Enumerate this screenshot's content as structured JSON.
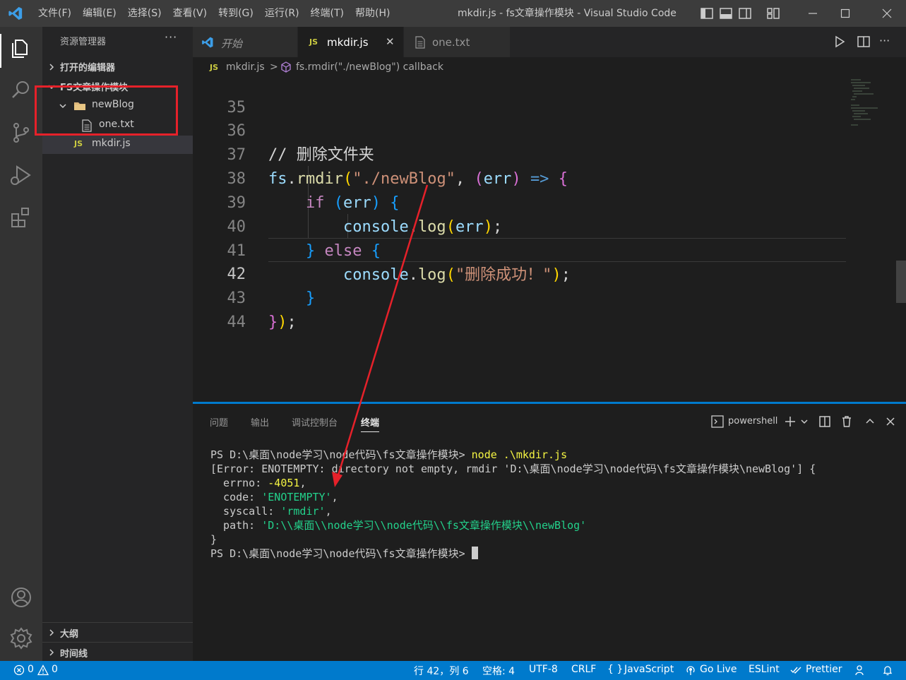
{
  "window": {
    "title": "mkdir.js - fs文章操作模块 - Visual Studio Code"
  },
  "menu": [
    "文件(F)",
    "编辑(E)",
    "选择(S)",
    "查看(V)",
    "转到(G)",
    "运行(R)",
    "终端(T)",
    "帮助(H)"
  ],
  "sidebar": {
    "title": "资源管理器",
    "more": "···",
    "open_editors": "打开的编辑器",
    "project": "FS文章操作模块",
    "folder": "newBlog",
    "file_txt": "one.txt",
    "file_js_badge": "JS",
    "file_js": "mkdir.js",
    "outline": "大纲",
    "timeline": "时间线"
  },
  "tabs": [
    {
      "label": "开始"
    },
    {
      "badge": "JS",
      "label": "mkdir.js",
      "close": "✕"
    },
    {
      "label": "one.txt"
    }
  ],
  "breadcrumb": {
    "badge": "JS",
    "file": "mkdir.js",
    "sep": ">",
    "symbol": "fs.rmdir(\"./newBlog\") callback"
  },
  "code": {
    "line_numbers": [
      "35",
      "36",
      "37",
      "38",
      "39",
      "40",
      "41",
      "42",
      "43",
      "44"
    ],
    "current_line": "42",
    "comment": "// 删除文件夹",
    "success_msg": "\"删除成功！\""
  },
  "panel": {
    "tabs": [
      "问题",
      "输出",
      "调试控制台",
      "终端"
    ],
    "active_tab": "终端",
    "shell": "powershell",
    "terminal": {
      "prompt": "PS D:\\桌面\\node学习\\node代码\\fs文章操作模块>",
      "command": "node .\\mkdir.js",
      "error_line": "[Error: ENOTEMPTY: directory not empty, rmdir 'D:\\桌面\\node学习\\node代码\\fs文章操作模块\\newBlog'] {",
      "errno_key": "  errno: ",
      "errno_val": "-4051",
      "code_key": "  code: ",
      "code_val": "'ENOTEMPTY'",
      "syscall_key": "  syscall: ",
      "syscall_val": "'rmdir'",
      "path_key": "  path: ",
      "path_val": "'D:\\\\桌面\\\\node学习\\\\node代码\\\\fs文章操作模块\\\\newBlog'",
      "close_brace": "}",
      "comma": ","
    }
  },
  "statusbar": {
    "errors": "0",
    "warnings": "0",
    "position": "行 42，列 6",
    "spaces": "空格: 4",
    "encoding": "UTF-8",
    "eol": "CRLF",
    "language": "JavaScript",
    "golive": "Go Live",
    "eslint": "ESLint",
    "prettier": "Prettier"
  },
  "colors": {
    "accent": "#007acc",
    "annotation": "#e6212a"
  }
}
